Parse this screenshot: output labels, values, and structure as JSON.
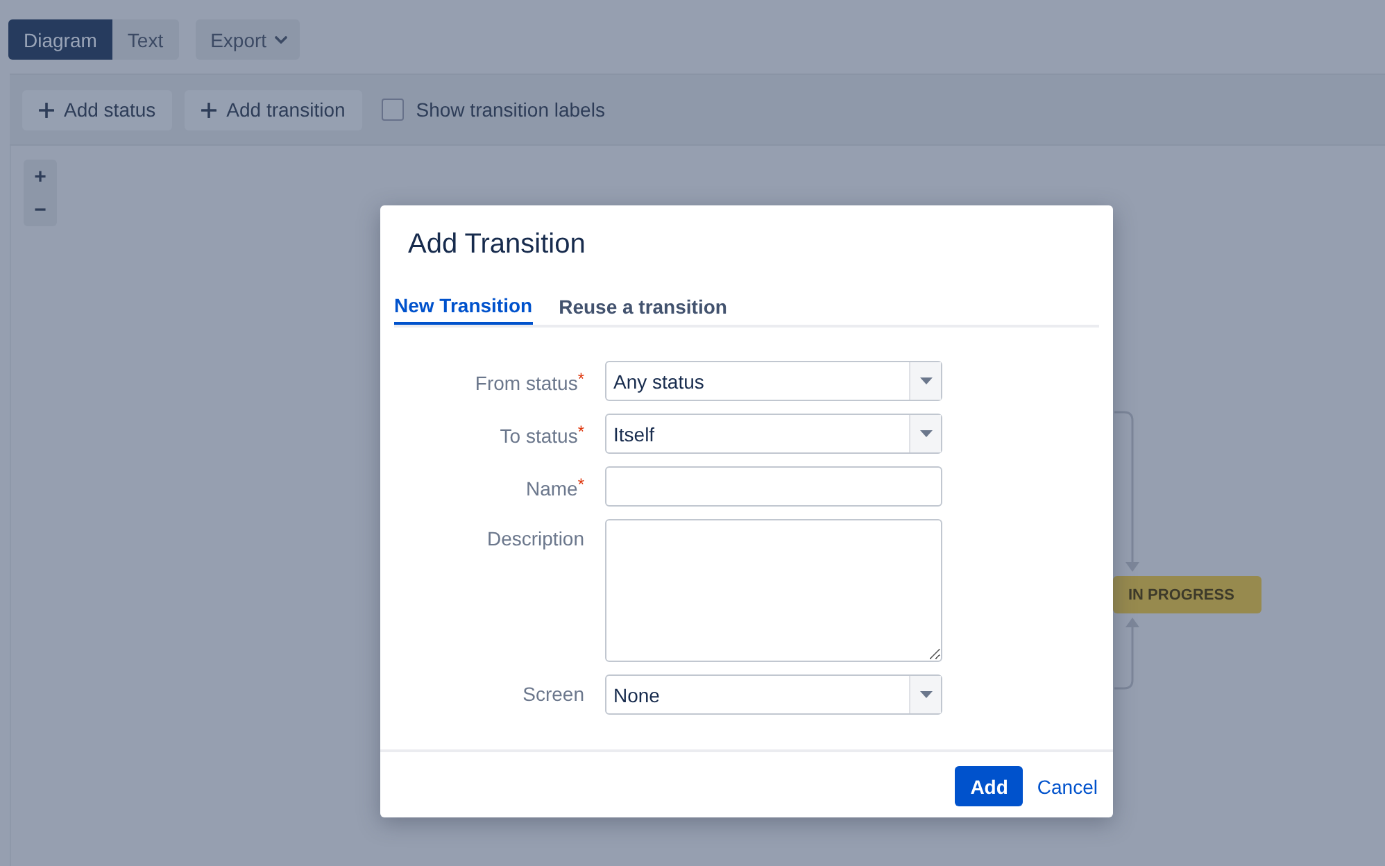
{
  "view_tabs": [
    {
      "label": "Diagram",
      "selected": true
    },
    {
      "label": "Text",
      "selected": false
    }
  ],
  "export_button": {
    "label": "Export"
  },
  "toolbar": {
    "buttons": [
      {
        "label": "Add status"
      },
      {
        "label": "Add transition"
      }
    ],
    "show_labels": {
      "label": "Show transition labels",
      "checked": false
    }
  },
  "zoom_controls": [
    "+",
    "−"
  ],
  "diagram": {
    "status": {
      "label": "IN PROGRESS",
      "color": "#978a4e"
    }
  },
  "dialog": {
    "title": "Add Transition",
    "tabs": [
      {
        "label": "New Transition",
        "selected": true
      },
      {
        "label": "Reuse a transition",
        "selected": false
      }
    ],
    "fields": [
      {
        "kind": "select",
        "label": "From status",
        "required_mark": "*",
        "value": "Any status"
      },
      {
        "kind": "select",
        "label": "To status",
        "required_mark": "*",
        "value": "Itself"
      },
      {
        "kind": "text",
        "label": "Name",
        "required_mark": "*"
      },
      {
        "kind": "textarea",
        "label": "Description"
      },
      {
        "kind": "select",
        "label": "Screen",
        "value": "None"
      }
    ],
    "primary_button": "Add",
    "cancel_link": "Cancel"
  }
}
